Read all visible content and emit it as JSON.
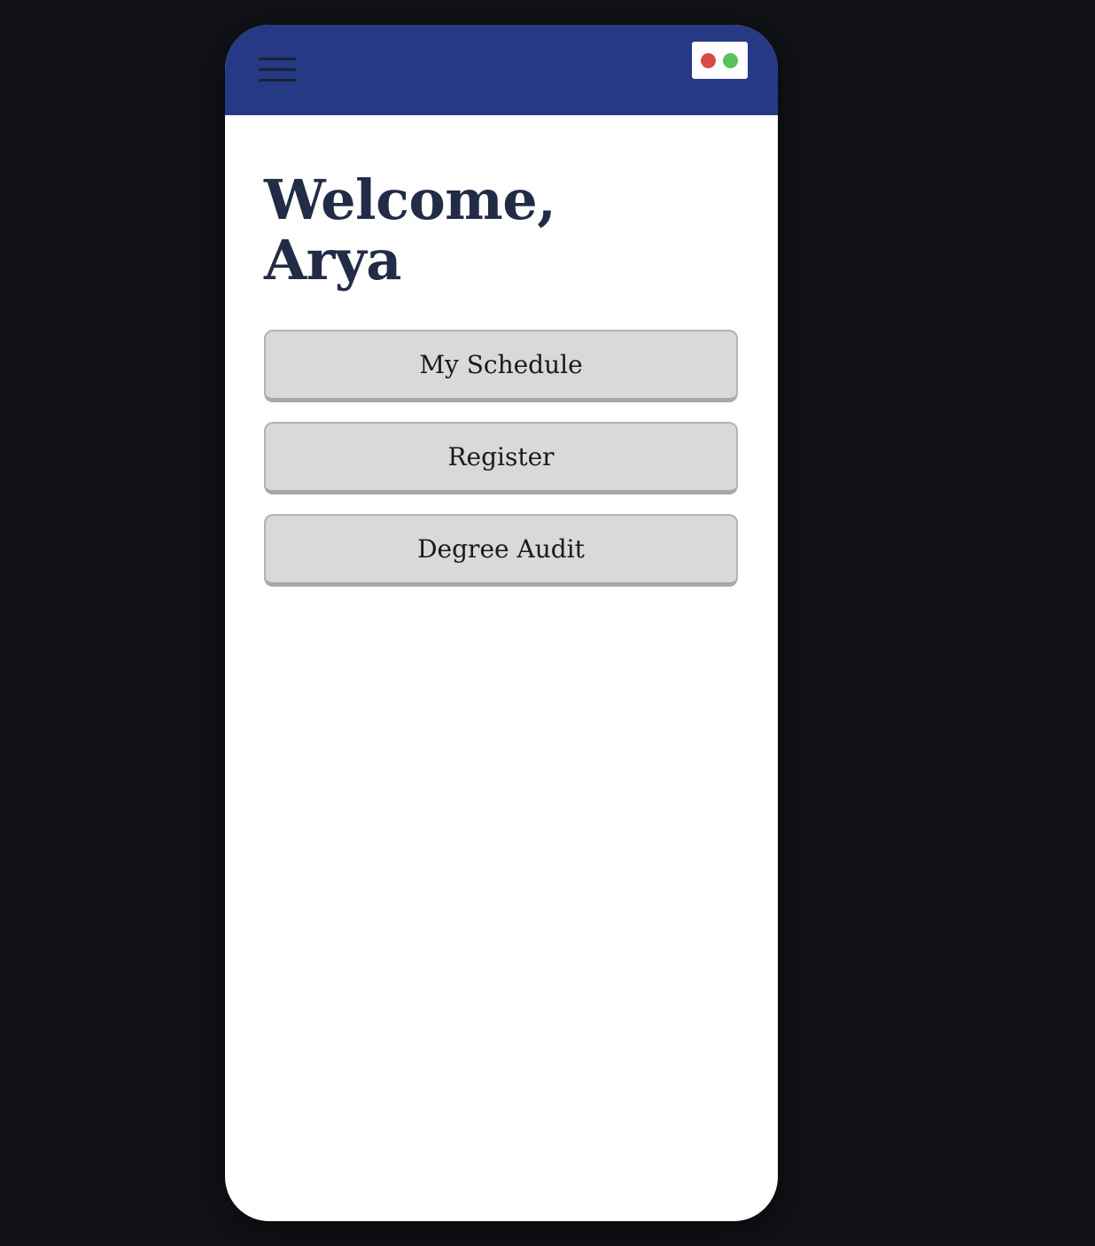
{
  "colors": {
    "background": "#111216",
    "header": "#263985",
    "heading_text": "#222c46",
    "button_fill": "#d9d9d9",
    "status_red": "#d94a46",
    "status_green": "#5ac25a"
  },
  "header": {
    "menu_icon": "hamburger-menu-icon",
    "status_indicator": {
      "dots": [
        "red",
        "green"
      ]
    }
  },
  "welcome": {
    "line1": "Welcome,",
    "line2": "Arya"
  },
  "nav_buttons": [
    {
      "label": "My Schedule"
    },
    {
      "label": "Register"
    },
    {
      "label": "Degree Audit"
    }
  ]
}
